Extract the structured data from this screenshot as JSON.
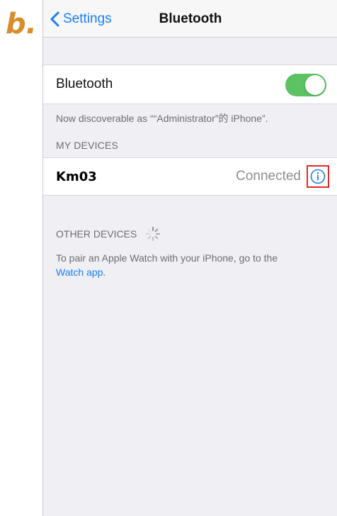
{
  "figure_label": "b.",
  "navbar": {
    "back_label": "Settings",
    "title": "Bluetooth"
  },
  "bluetooth": {
    "label": "Bluetooth",
    "toggle_on": true,
    "toggle_color": "#5cc263",
    "discoverable_text": "Now discoverable as ““Administrator”的 iPhone”."
  },
  "my_devices": {
    "header": "MY DEVICES",
    "items": [
      {
        "name": "Km03",
        "status": "Connected",
        "icon": "info-icon"
      }
    ]
  },
  "other_devices": {
    "header": "OTHER DEVICES",
    "icon": "loading-spinner-icon"
  },
  "pairing": {
    "text": "To pair an Apple Watch with your iPhone, go to the",
    "link": "Watch app",
    "end": "."
  },
  "colors": {
    "accent": "#1a7ff2",
    "highlight_box": "#e02a2a",
    "figure_label": "#d98c2b"
  }
}
